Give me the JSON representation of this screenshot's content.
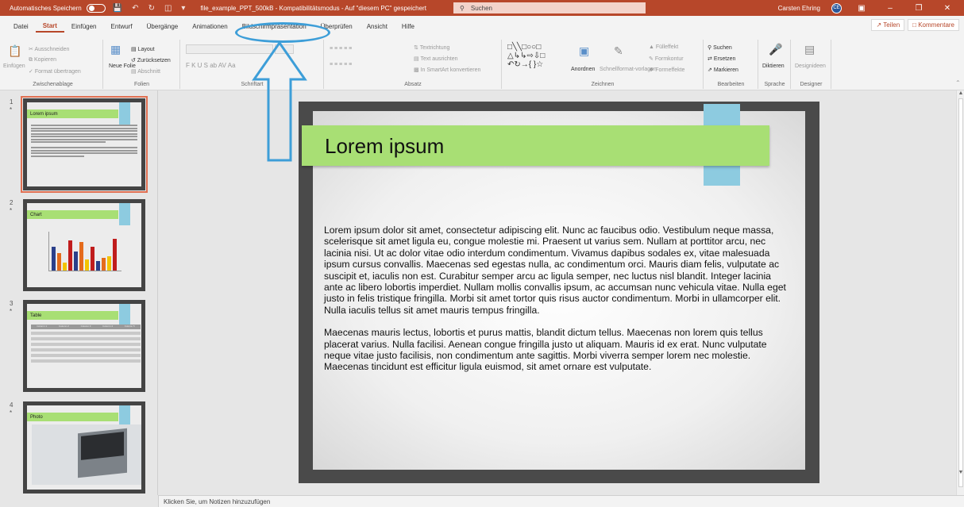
{
  "titlebar": {
    "autosave_label": "Automatisches Speichern",
    "file_title": "file_example_PPT_500kB  -  Kompatibilitätsmodus  -  Auf \"diesem PC\" gespeichert",
    "search_placeholder": "Suchen",
    "user_name": "Carsten Ehring",
    "user_initials": "CE",
    "accent_color": "#b7472a"
  },
  "menu": {
    "tabs": [
      "Datei",
      "Start",
      "Einfügen",
      "Entwurf",
      "Übergänge",
      "Animationen",
      "Bildschirmpräsentation",
      "Überprüfen",
      "Ansicht",
      "Hilfe"
    ],
    "active_tab": "Start",
    "share_label": "Teilen",
    "comments_label": "Kommentare"
  },
  "ribbon": {
    "clipboard": {
      "paste": "Einfügen",
      "cut": "Ausschneiden",
      "copy": "Kopieren",
      "format_painter": "Format übertragen",
      "label": "Zwischenablage"
    },
    "slides": {
      "new_slide": "Neue Folie",
      "layout": "Layout",
      "reset": "Zurücksetzen",
      "section": "Abschnitt",
      "label": "Folien"
    },
    "font": {
      "label": "Schriftart",
      "font_buttons": "F  K  U  S  ab  AV  Aa"
    },
    "paragraph": {
      "text_direction": "Textrichtung",
      "align_text": "Text ausrichten",
      "smartart": "In SmartArt konvertieren",
      "label": "Absatz"
    },
    "drawing": {
      "arrange": "Anordnen",
      "quick_styles": "Schnellformat-vorlagen",
      "fill": "Fülleffekt",
      "outline": "Formkontur",
      "effects": "Formeffekte",
      "label": "Zeichnen"
    },
    "editing": {
      "find": "Suchen",
      "replace": "Ersetzen",
      "select": "Markieren",
      "label": "Bearbeiten"
    },
    "voice": {
      "dictate": "Diktieren",
      "label": "Sprache"
    },
    "designer": {
      "ideas": "Designideen",
      "label": "Designer"
    }
  },
  "thumbnails": [
    {
      "number": "1",
      "title": "Lorem ipsum",
      "kind": "text"
    },
    {
      "number": "2",
      "title": "Chart",
      "kind": "chart"
    },
    {
      "number": "3",
      "title": "Table",
      "kind": "table"
    },
    {
      "number": "4",
      "title": "Photo",
      "kind": "photo"
    }
  ],
  "thumbnail_star": "*",
  "mini_table_headers": [
    "Column 1",
    "Column 2",
    "Column 3",
    "Column 4",
    "Column 5"
  ],
  "slide": {
    "title": "Lorem ipsum",
    "paragraph1": "Lorem ipsum dolor sit amet, consectetur adipiscing elit. Nunc ac faucibus odio. Vestibulum neque massa, scelerisque sit amet ligula eu, congue molestie mi. Praesent ut varius sem. Nullam at porttitor arcu, nec lacinia nisi. Ut ac dolor vitae odio interdum condimentum. Vivamus dapibus sodales ex, vitae malesuada ipsum cursus convallis. Maecenas sed egestas nulla, ac condimentum orci. Mauris diam felis, vulputate ac suscipit et, iaculis non est. Curabitur semper arcu ac ligula semper, nec luctus nisl blandit. Integer lacinia ante ac libero lobortis imperdiet. Nullam mollis convallis ipsum, ac accumsan nunc vehicula vitae. Nulla eget justo in felis tristique fringilla. Morbi sit amet tortor quis risus auctor condimentum. Morbi in ullamcorper elit. Nulla iaculis tellus sit amet mauris tempus fringilla.",
    "paragraph2": "Maecenas mauris lectus, lobortis et purus mattis, blandit dictum tellus. Maecenas non lorem quis tellus placerat varius. Nulla facilisi. Aenean congue fringilla justo ut aliquam. Mauris id ex erat. Nunc vulputate neque vitae justo facilisis, non condimentum ante sagittis. Morbi viverra semper lorem nec molestie. Maecenas tincidunt est efficitur ligula euismod, sit amet ornare est vulputate.",
    "title_bar_color": "#a8df74",
    "tab_color": "#8dcbe0"
  },
  "notes_placeholder": "Klicken Sie, um Notizen hinzuzufügen",
  "annotation_color": "#3d9ed8"
}
